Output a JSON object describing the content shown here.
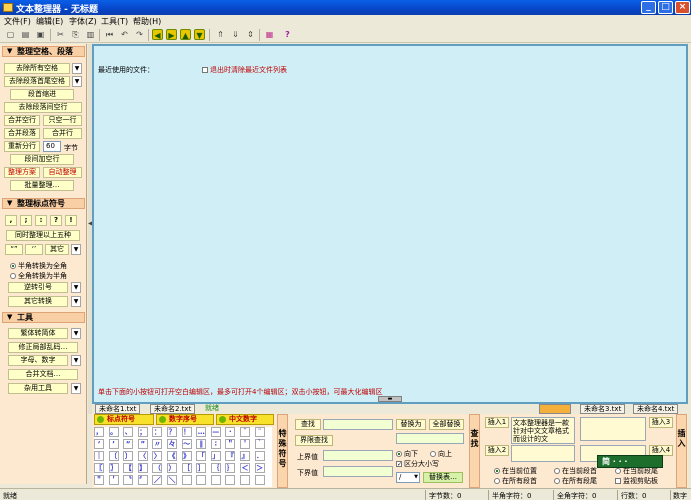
{
  "window": {
    "title": "文本整理器 - 无标题",
    "minimize": "_",
    "maximize": "□",
    "close": "×"
  },
  "menu": [
    "文件(F)",
    "编辑(E)",
    "字体(Z)",
    "工具(T)",
    "帮助(H)"
  ],
  "toolbar": {
    "help": "?"
  },
  "left": {
    "sec1": {
      "title": "整理空格、段落"
    },
    "remove_all_spaces": "去除所有空格",
    "remove_para_spaces": "去除段落首尾空格",
    "indent": "段首缩进",
    "remove_blank_lines": "去除段落间空行",
    "merge_blank": "合并空行",
    "keep_one": "只空一行",
    "merge_para": "合并段落",
    "merge_line": "合并行",
    "rewrap": "重新分行",
    "wrap_width": "60",
    "wrap_unit": "字节",
    "add_blank": "段间加空行",
    "scheme": "整理方案",
    "auto": "自动整理",
    "batch": "批量整理…",
    "sec2": {
      "title": "整理标点符号"
    },
    "punct_buttons": [
      ",",
      ";",
      ":",
      "?",
      "!"
    ],
    "simultaneous": "同时整理以上五种",
    "quote1": "“”",
    "quote2": "‘’",
    "other": "其它",
    "half_to_full": "半角转换为全角",
    "full_to_half": "全角转换为半角",
    "reverse_quote": "逆转引号",
    "other_convert": "其它转换",
    "sec3": {
      "title": "工具"
    },
    "trad_simp": "繁体转简体",
    "fix_garbled": "修正局部乱码…",
    "letters_digits": "字母、数字",
    "merge_docs": "合并文档…",
    "misc_tools": "杂用工具"
  },
  "editor": {
    "recent_label": "最近使用的文件：",
    "clear_recent": "退出时清除最近文件列表",
    "hint": "单击下面的小按钮可打开空白编辑区，最多可打开4个编辑区；双击小按钮，可最大化编辑区"
  },
  "tabs": [
    "未命名1.txt",
    "未命名2.txt",
    "就绪"
  ],
  "tabs_right": [
    "未命名3.txt",
    "未命名4.txt"
  ],
  "bottom": {
    "sym_tabs": [
      "标点符号",
      "数字序号",
      "中文数字"
    ],
    "symbols": [
      "，",
      "。",
      "、",
      "；",
      "：",
      "？",
      "！",
      "…",
      "—",
      "·",
      "ˉ",
      "¨",
      "‘",
      "’",
      "“",
      "”",
      "〃",
      "々",
      "～",
      "‖",
      "∶",
      "＂",
      "＇",
      "｀",
      "｜",
      "〔",
      "〕",
      "〈",
      "〉",
      "《",
      "》",
      "「",
      "」",
      "『",
      "』",
      "．",
      "〖",
      "〗",
      "【",
      "】",
      "（",
      "）",
      "［",
      "］",
      "｛",
      "｝",
      "＜",
      "＞",
      "＂",
      "＇",
      "〝",
      "〞",
      "／",
      "＼",
      "",
      "",
      "",
      "",
      "",
      ""
    ],
    "special_sym": "特殊符号",
    "find": "查找",
    "replace_with": "替换为",
    "replace_all": "全部替换",
    "boundary_find": "界限查找",
    "upper": "上界值",
    "lower": "下界值",
    "down": "向下",
    "up": "向上",
    "case": "区分大小写",
    "slash": "/",
    "replace_table": "替换表…",
    "find_vertical": "查找",
    "insert1": "插入1",
    "insert2": "插入2",
    "insert3": "插入3",
    "insert4": "插入4",
    "insert_vertical": "插入",
    "paste_text": "文本整理器是一款针对中文文章格式而设计的文",
    "pos1": "在当前位置",
    "pos2": "在当前段首",
    "pos3": "在当前段尾",
    "pos4": "在所有段首",
    "pos5": "在所有段尾",
    "pos6": "监视剪贴板",
    "float_label": "简 · · ·"
  },
  "status": {
    "ready": "就绪",
    "bytes": "字节数：0",
    "half": "半角字符：0",
    "full": "全角字符：0",
    "lines": "行数：0",
    "num": "数字"
  }
}
